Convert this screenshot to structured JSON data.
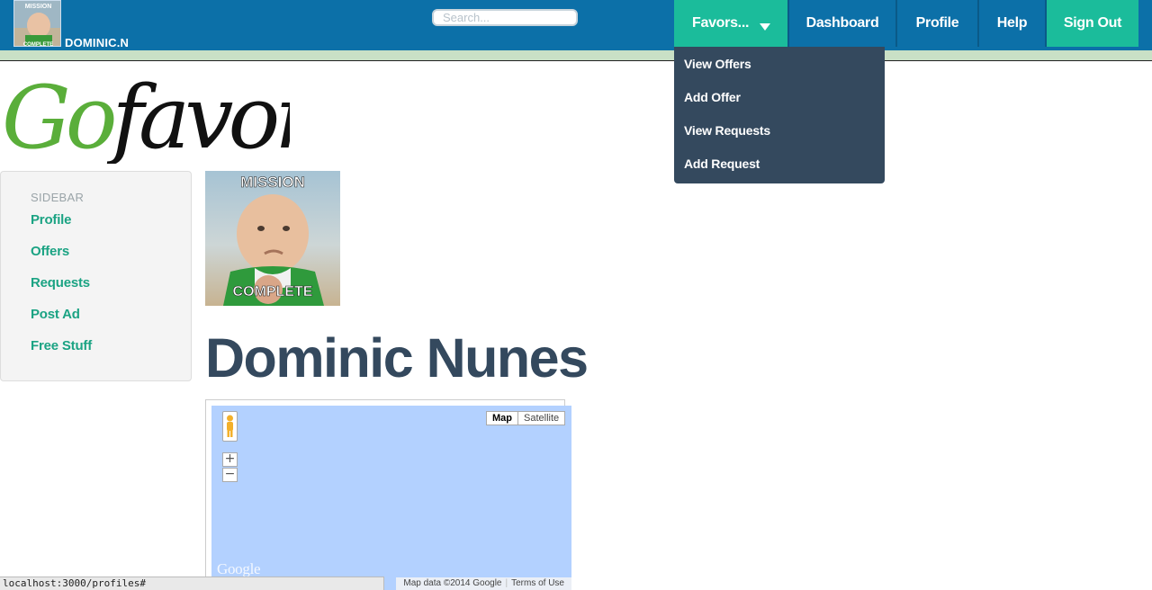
{
  "header": {
    "username": "DOMINIC.N",
    "search_placeholder": "Search...",
    "nav": {
      "favors": "Favors...",
      "dashboard": "Dashboard",
      "profile": "Profile",
      "help": "Help",
      "sign_out": "Sign Out"
    },
    "colors": {
      "bar": "#0c70a8",
      "accent": "#1bbc9b"
    }
  },
  "dropdown": {
    "items": [
      "View Offers",
      "Add Offer",
      "View Requests",
      "Add Request"
    ]
  },
  "logo": {
    "text": "Gofavorit"
  },
  "sidebar": {
    "heading": "SIDEBAR",
    "links": [
      "Profile",
      "Offers",
      "Requests",
      "Post Ad",
      "Free Stuff"
    ]
  },
  "avatar_meme": {
    "top": "MISSION",
    "bottom": "COMPLETE"
  },
  "profile": {
    "name": "Dominic Nunes"
  },
  "map": {
    "type_map": "Map",
    "type_satellite": "Satellite",
    "zoom_in": "+",
    "zoom_out": "−",
    "watermark": "Google",
    "attribution": "Map data ©2014 Google",
    "terms": "Terms of Use"
  },
  "statusbar": {
    "url": "localhost:3000/profiles#"
  }
}
